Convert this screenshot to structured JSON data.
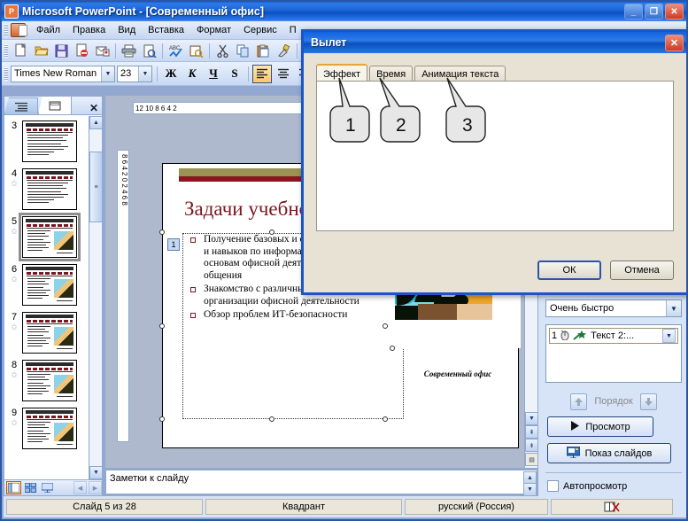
{
  "window": {
    "title": "Microsoft PowerPoint - [Современный офис]",
    "app_icon": "powerpoint-icon",
    "minimize_label": "_",
    "maximize_label": "❐",
    "close_label": "✕"
  },
  "menu": {
    "items": [
      {
        "label": "Файл"
      },
      {
        "label": "Правка"
      },
      {
        "label": "Вид"
      },
      {
        "label": "Вставка"
      },
      {
        "label": "Формат"
      },
      {
        "label": "Сервис"
      },
      {
        "label": "П"
      }
    ]
  },
  "standard_toolbar": {
    "icons": [
      {
        "name": "new-document-icon",
        "glyph": "🗋"
      },
      {
        "name": "open-folder-icon",
        "glyph": "📂"
      },
      {
        "name": "save-icon",
        "glyph": "💾"
      },
      {
        "name": "permission-icon",
        "glyph": "🗎"
      },
      {
        "name": "email-icon",
        "glyph": "📧"
      },
      {
        "name": "print-icon",
        "glyph": "🖨"
      },
      {
        "name": "print-preview-icon",
        "glyph": "🔍"
      },
      {
        "name": "spellcheck-icon",
        "glyph": "ABC"
      },
      {
        "name": "research-icon",
        "glyph": "📕"
      },
      {
        "name": "cut-icon",
        "glyph": "✂"
      },
      {
        "name": "copy-icon",
        "glyph": "📄"
      },
      {
        "name": "paste-icon",
        "glyph": "📋"
      },
      {
        "name": "format-painter-icon",
        "glyph": "🖌"
      }
    ]
  },
  "format_toolbar": {
    "font_name": "Times New Roman",
    "font_size": "23",
    "bold_label": "Ж",
    "italic_label": "К",
    "underline_label": "Ч",
    "shadow_label": "S",
    "align_left_label": "≡",
    "align_center_label": "≡",
    "align_right_label": "≡"
  },
  "left_pane": {
    "tab_outline": "outline-tab",
    "tab_slides": "slides-tab",
    "close_label": "✕",
    "slides": [
      {
        "number": "3",
        "has_star": false,
        "has_image": false,
        "selected": false
      },
      {
        "number": "4",
        "has_star": true,
        "has_image": false,
        "selected": false
      },
      {
        "number": "5",
        "has_star": true,
        "has_image": true,
        "selected": true
      },
      {
        "number": "6",
        "has_star": true,
        "has_image": true,
        "selected": false
      },
      {
        "number": "7",
        "has_star": true,
        "has_image": true,
        "selected": false
      },
      {
        "number": "8",
        "has_star": true,
        "has_image": true,
        "selected": false
      },
      {
        "number": "9",
        "has_star": true,
        "has_image": true,
        "selected": false
      }
    ],
    "view_buttons": [
      {
        "name": "normal-view-button",
        "glyph": "▤",
        "active": true
      },
      {
        "name": "slide-sorter-button",
        "glyph": "▦",
        "active": false
      },
      {
        "name": "slideshow-button",
        "glyph": "🖵",
        "active": false
      }
    ]
  },
  "rulers": {
    "horizontal": "12   10    8    6    4    2",
    "vertical": "8 6 4 2 0 2 4 6 8"
  },
  "slide": {
    "animation_tag": "1",
    "title": "Задачи учебно",
    "bullets": [
      "Получение базовых и специальных знаний, у и навыков по информационным технологиям, основам офисной деятельности и делового общения",
      "Знакомство с различными аспектами организации офисной деятельности",
      "Обзор проблем ИТ-безопасности"
    ],
    "picture_caption": "Современный офис"
  },
  "notes": {
    "placeholder_text": "Заметки к слайду"
  },
  "task_pane": {
    "speed_value": "Очень быстро",
    "animation_item": {
      "index": "1",
      "mouse_icon": "mouse-click-icon",
      "effect_icon": "star-effect-icon",
      "label": "Текст 2:...",
      "dropdown": "▾"
    },
    "order_label": "Порядок",
    "order_up": "▲",
    "order_down": "▼",
    "preview_label": "Просмотр",
    "preview_icon": "play-icon",
    "slideshow_label": "Показ слайдов",
    "slideshow_icon": "projector-icon",
    "autopreview_label": "Автопросмотр",
    "autopreview_checked": false
  },
  "status_bar": {
    "slide_counter": "Слайд 5 из 28",
    "design_name": "Квадрант",
    "language": "русский (Россия)",
    "spell_icon": "spellcheck-status-icon"
  },
  "dialog": {
    "title": "Вылет",
    "close_label": "✕",
    "tabs": [
      {
        "label": "Эффект",
        "active": true
      },
      {
        "label": "Время",
        "active": false
      },
      {
        "label": "Анимация текста",
        "active": false
      }
    ],
    "callouts": [
      {
        "label": "1"
      },
      {
        "label": "2"
      },
      {
        "label": "3"
      }
    ],
    "ok_label": "ОК",
    "cancel_label": "Отмена"
  },
  "colors": {
    "titlebar_blue": "#1263e0",
    "dialog_border": "#1b55c6",
    "slide_title_red": "#7b1520",
    "taskpane_bg": "#d7e3f7",
    "accent_orange": "#e8a33d"
  }
}
